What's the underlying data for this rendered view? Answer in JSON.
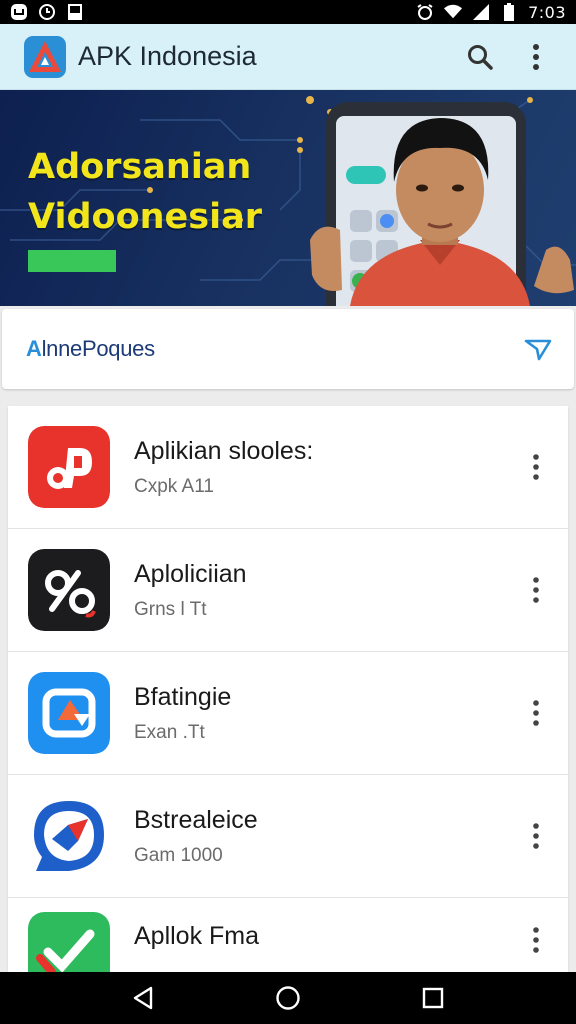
{
  "status_bar": {
    "time": "7:03"
  },
  "app_bar": {
    "title": "APK Indonesia"
  },
  "banner": {
    "line1": "Adorsanian",
    "line2": "Vidoonesiar"
  },
  "filter": {
    "prefix": "A",
    "label": "lnnePoques"
  },
  "apps": [
    {
      "name": "Aplikian slooles:",
      "meta": "Cxpk A11"
    },
    {
      "name": "Aploliciian",
      "meta": "Grns l Tt"
    },
    {
      "name": "Bfatingie",
      "meta": "Exan .Tt"
    },
    {
      "name": "Bstrealeice",
      "meta": "Gam 1000"
    },
    {
      "name": "Apllok Fma",
      "meta": ""
    }
  ],
  "colors": {
    "app_bar": "#d8f1f8",
    "banner_text": "#f2e51c",
    "accent": "#2a8fd8"
  }
}
